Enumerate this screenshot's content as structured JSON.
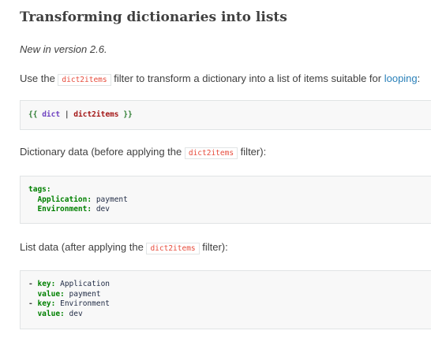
{
  "heading": "Transforming dictionaries into lists",
  "version_note": "New in version 2.6.",
  "intro": {
    "prefix": "Use the ",
    "code": "dict2items",
    "middle": " filter to transform a dictionary into a list of items suitable for ",
    "link": "looping",
    "suffix": ":"
  },
  "usage_code": {
    "open": "{{",
    "var": "dict",
    "pipe": "|",
    "filter": "dict2items",
    "close": "}}"
  },
  "dict_intro": {
    "prefix": "Dictionary data (before applying the ",
    "code": "dict2items",
    "suffix": " filter):"
  },
  "dict_code": {
    "root_key": "tags:",
    "items": [
      {
        "key": "Application:",
        "value": "payment"
      },
      {
        "key": "Environment:",
        "value": "dev"
      }
    ]
  },
  "list_intro": {
    "prefix": "List data (after applying the ",
    "code": "dict2items",
    "suffix": " filter):"
  },
  "list_code": {
    "dash": "-",
    "key_label": "key:",
    "value_label": "value:",
    "items": [
      {
        "key": "Application",
        "value": "payment"
      },
      {
        "key": "Environment",
        "value": "dev"
      }
    ]
  }
}
